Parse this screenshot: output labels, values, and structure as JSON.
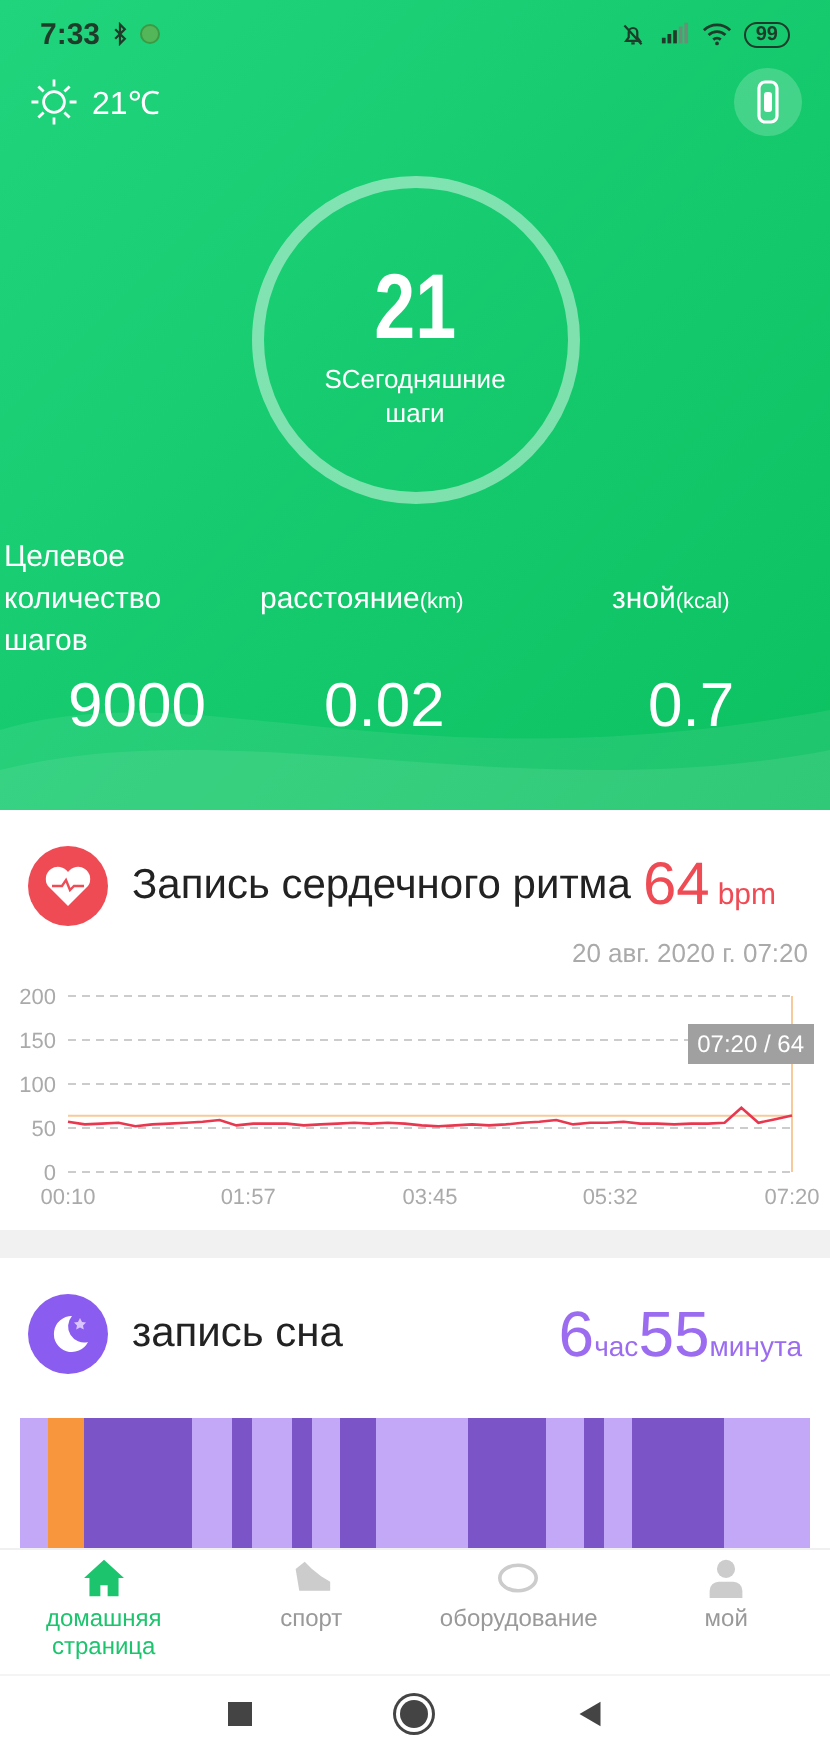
{
  "status_bar": {
    "time": "7:33",
    "battery": "99"
  },
  "weather": {
    "temperature": "21℃"
  },
  "steps": {
    "value": "21",
    "label": "SCегодняшние шаги"
  },
  "stats": [
    {
      "label": "Целевое количество шагов",
      "value": "9000"
    },
    {
      "label": "расстояние",
      "unit": "(km)",
      "value": "0.02"
    },
    {
      "label": "зной",
      "unit": "(kcal)",
      "value": "0.7"
    }
  ],
  "heart": {
    "title": "Запись сердечного ритма",
    "value": "64",
    "unit": "bpm",
    "date": "20 авг. 2020 г. 07:20",
    "tooltip": "07:20 / 64",
    "chart_data": {
      "type": "line",
      "x": [
        10,
        20,
        30,
        40,
        50,
        60,
        70,
        80,
        90,
        100,
        110,
        120,
        130,
        140,
        150,
        160,
        170,
        180,
        190,
        200,
        210,
        220,
        230,
        240,
        250,
        260,
        270,
        280,
        290,
        300,
        310,
        320,
        330,
        340,
        350,
        360,
        370,
        380,
        390,
        400,
        410,
        420,
        430,
        440
      ],
      "series": [
        {
          "color": "#e8384f",
          "values": [
            57,
            54,
            55,
            56,
            52,
            54,
            55,
            56,
            57,
            59,
            53,
            55,
            55,
            55,
            53,
            54,
            55,
            56,
            55,
            56,
            55,
            53,
            52,
            53,
            54,
            53,
            54,
            56,
            57,
            59,
            54,
            56,
            56,
            57,
            55,
            55,
            54,
            55,
            55,
            56,
            73,
            56,
            60,
            64
          ]
        }
      ],
      "grid": true,
      "ref_lines": [
        {
          "axis": "y",
          "value": 64
        },
        {
          "axis": "x",
          "value": 440
        }
      ],
      "xlim": [
        10,
        440
      ],
      "ylim": [
        0,
        200
      ],
      "yticks": [
        0,
        50,
        100,
        150,
        200
      ],
      "xticks": [
        {
          "value": 10,
          "label": "00:10"
        },
        {
          "value": 117,
          "label": "01:57"
        },
        {
          "value": 225,
          "label": "03:45"
        },
        {
          "value": 332,
          "label": "05:32"
        },
        {
          "value": 440,
          "label": "07:20"
        }
      ]
    }
  },
  "sleep": {
    "title": "запись сна",
    "hours": "6",
    "hours_unit": "час",
    "minutes": "55",
    "minutes_unit": "минута",
    "segments": [
      {
        "color": "#c4a8f8"
      },
      {
        "color": "#f7963c"
      },
      {
        "color": "#7b55c8"
      },
      {
        "color": "#c4a8f8"
      },
      {
        "color": "#7b55c8"
      },
      {
        "color": "#c4a8f8"
      },
      {
        "color": "#7b55c8"
      },
      {
        "color": "#c4a8f8"
      },
      {
        "color": "#7b55c8"
      },
      {
        "color": "#c4a8f8"
      },
      {
        "color": "#7b55c8"
      },
      {
        "color": "#c4a8f8"
      },
      {
        "color": "#7b55c8"
      },
      {
        "color": "#c4a8f8"
      },
      {
        "color": "#7b55c8"
      },
      {
        "color": "#c4a8f8"
      }
    ]
  },
  "nav": [
    {
      "kind": "home",
      "label": "домашняя страница",
      "selected": true
    },
    {
      "kind": "sport",
      "label": "спорт",
      "selected": false
    },
    {
      "kind": "device",
      "label": "оборудование",
      "selected": false
    },
    {
      "kind": "profile",
      "label": "мой",
      "selected": false
    }
  ]
}
